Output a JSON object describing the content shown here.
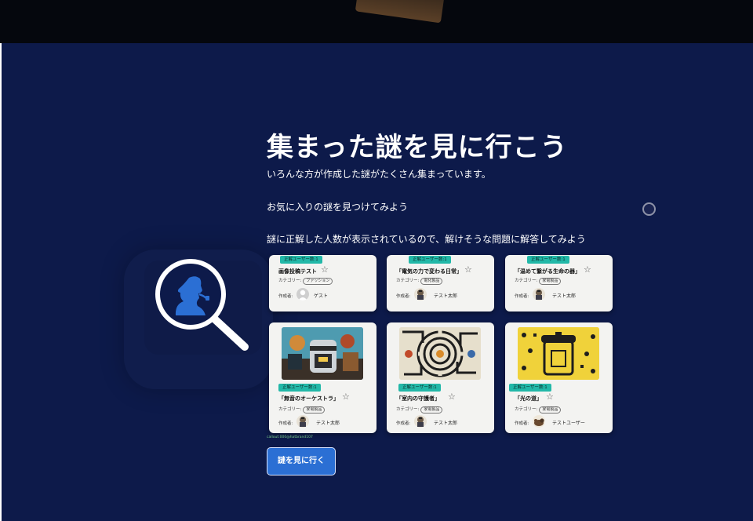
{
  "hero": {
    "title": "集まった謎を見に行こう",
    "paragraphs": [
      "いろんな方が作成した謎がたくさん集まっています。",
      "お気に入りの謎を見つけてみよう",
      "謎に正解した人数が表示されているので、解けそうな問題に解答してみよう"
    ]
  },
  "cards": [
    {
      "badge": "正解ユーザー数:1",
      "title": "画像投稿テスト",
      "category_label": "カテゴリー:",
      "category": "ファッション",
      "author_label": "作成者:",
      "author": "ゲスト",
      "avatar_icon": "default-user-icon"
    },
    {
      "badge": "正解ユーザー数:1",
      "title": "「電気の力で変わる日常」",
      "category_label": "カテゴリー:",
      "category": "電化製品",
      "author_label": "作成者:",
      "author": "テスト太郎",
      "avatar_icon": "character-icon"
    },
    {
      "badge": "正解ユーザー数:1",
      "title": "「温めて繋がる生命の器」",
      "category_label": "カテゴリー:",
      "category": "家電製品",
      "author_label": "作成者:",
      "author": "テスト太郎",
      "avatar_icon": "character-icon"
    },
    {
      "badge": "正解ユーザー数:1",
      "title": "「無音のオーケストラ」",
      "category_label": "カテゴリー:",
      "category": "家電製品",
      "author_label": "作成者:",
      "author": "テスト太郎",
      "avatar_icon": "character-icon",
      "thumb": "appliance-collage-image"
    },
    {
      "badge": "正解ユーザー数:1",
      "title": "「室内の守護者」",
      "category_label": "カテゴリー:",
      "category": "家電製品",
      "author_label": "作成者:",
      "author": "テスト太郎",
      "avatar_icon": "character-icon",
      "thumb": "maze-image"
    },
    {
      "badge": "正解ユーザー数:1",
      "title": "「光の道」",
      "category_label": "カテゴリー:",
      "category": "家電製品",
      "author_label": "作成者:",
      "author": "テストユーザー",
      "avatar_icon": "animal-icon",
      "thumb": "rice-cooker-yellow-image"
    }
  ],
  "tiny_link": "callout:000@hatbrand107",
  "cta": {
    "label": "謎を見に行く"
  },
  "icons": {
    "magnifier": "detective-magnifier-icon",
    "star": "star-outline-icon"
  },
  "colors": {
    "background": "#0d1a4a",
    "accent": "#2b6fd4",
    "badge": "#22b8a8",
    "icon_blue": "#2b6fd4"
  }
}
